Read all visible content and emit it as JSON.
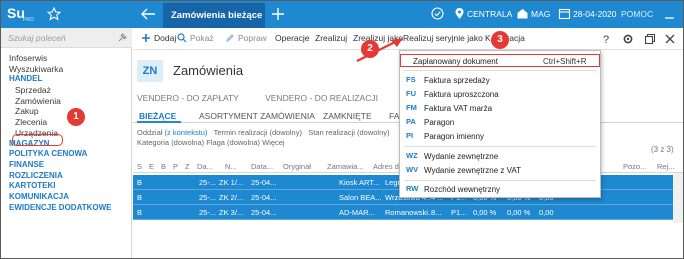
{
  "titlebar": {
    "logo": "Su",
    "logo_sub": "PRO",
    "active_tab": "Zamówienia bieżące",
    "company": "CENTRALA",
    "warehouse": "MAG",
    "date": "28-04-2020",
    "help": "POMOC",
    "colors": {
      "bar": "#1e88d0",
      "active_tab": "#1565a8"
    }
  },
  "sidebar": {
    "search_placeholder": "Szukaj poleceń",
    "items": [
      {
        "label": "Infoserwis",
        "kind": "item"
      },
      {
        "label": "Wyszukiwarka",
        "kind": "item"
      },
      {
        "label": "HANDEL",
        "kind": "section"
      },
      {
        "label": "Sprzedaż",
        "kind": "sub"
      },
      {
        "label": "Zamówienia",
        "kind": "sub"
      },
      {
        "label": "Zakup",
        "kind": "sub"
      },
      {
        "label": "Zlecenia",
        "kind": "sub"
      },
      {
        "label": "Urządzenia",
        "kind": "sub"
      },
      {
        "label": "MAGAZYN",
        "kind": "section"
      },
      {
        "label": "POLITYKA CENOWA",
        "kind": "section"
      },
      {
        "label": "FINANSE",
        "kind": "section"
      },
      {
        "label": "ROZLICZENIA",
        "kind": "section"
      },
      {
        "label": "KARTOTEKI",
        "kind": "section"
      },
      {
        "label": "KOMUNIKACJA",
        "kind": "section"
      },
      {
        "label": "EWIDENCJE DODATKOWE",
        "kind": "section"
      }
    ]
  },
  "toolbar": {
    "add": "Dodaj",
    "show": "Pokaż",
    "fix": "Popraw",
    "operations": "Operacje",
    "realize": "Zrealizuj",
    "realize_as": "Zrealizuj jako",
    "realize_serial": "Realizuj seryjnie jako",
    "kopia_prefix": "K",
    "kopia_suffix": "pia",
    "kopia_full": "Kopia",
    "kopia_suffix2": "kacja"
  },
  "page": {
    "code": "ZN",
    "title": "Zamówienia"
  },
  "subtabs": {
    "vendero_pay": "VENDERO - DO ZAPŁATY",
    "vendero_real": "VENDERO - DO REALIZACJI"
  },
  "tabs": {
    "current": "BIEŻĄCE",
    "assortment": "ASORTYMENT ZAMÓWIENIA",
    "closed": "ZAMKNIĘTE",
    "more": "FAK"
  },
  "filters": {
    "line1_a": "Oddział",
    "line1_link": "(z kontekstu)",
    "line1_b": "Termin realizacji (dowolny)",
    "line1_c": "Stan realizacji (dowolny)",
    "line2": "Kategoria (dowolna)   Flaga (dowolna)   Więcej"
  },
  "count_label": "(3 z 3)",
  "grid": {
    "headers": [
      "S",
      "E",
      "B",
      "P",
      "Z",
      "Da...",
      "N...",
      "Data...",
      "Oryginał",
      "Zamawia...",
      "Adres do...",
      "Pozo...",
      "Rej..."
    ],
    "rows": [
      {
        "b": "B",
        "z": "",
        "da": "25-...",
        "nr": "ZK 1/...",
        "data": "25-04...",
        "zam": "Kiosk ART...",
        "adres": "Legnicka..."
      },
      {
        "b": "B",
        "z": "",
        "da": "25-...",
        "nr": "ZK 2/...",
        "data": "25-04...",
        "zam": "Salon BEA...",
        "adres": "Wrzosowa 4...",
        "x1": "4 ...",
        "x2": "P1...",
        "x3": "0,00 %",
        "x4": "0,00 %",
        "x5": "0,00"
      },
      {
        "b": "B",
        "z": "",
        "da": "25-...",
        "nr": "ZK 3/...",
        "data": "25-04...",
        "zam": "AD-MAR...",
        "adres": "Romanowski...",
        "x1": "8...",
        "x2": "P1...",
        "x3": "0,00 %",
        "x4": "0,00 %",
        "x5": "0,00"
      }
    ]
  },
  "menu": {
    "items": [
      {
        "code": "",
        "label": "Zaplanowany dokument",
        "shortcut": "Ctrl+Shift+R"
      },
      {
        "code": "FS",
        "label": "Faktura sprzedaży"
      },
      {
        "code": "FU",
        "label": "Faktura uproszczona"
      },
      {
        "code": "FM",
        "label": "Faktura VAT marża"
      },
      {
        "code": "PA",
        "label": "Paragon"
      },
      {
        "code": "PI",
        "label": "Paragon imienny"
      },
      {
        "code": "WZ",
        "label": "Wydanie zewnętrzne"
      },
      {
        "code": "WV",
        "label": "Wydanie zewnętrzne z VAT"
      },
      {
        "code": "RW",
        "label": "Rozchód wewnętrzny"
      }
    ]
  },
  "badges": [
    "1",
    "2",
    "3"
  ]
}
